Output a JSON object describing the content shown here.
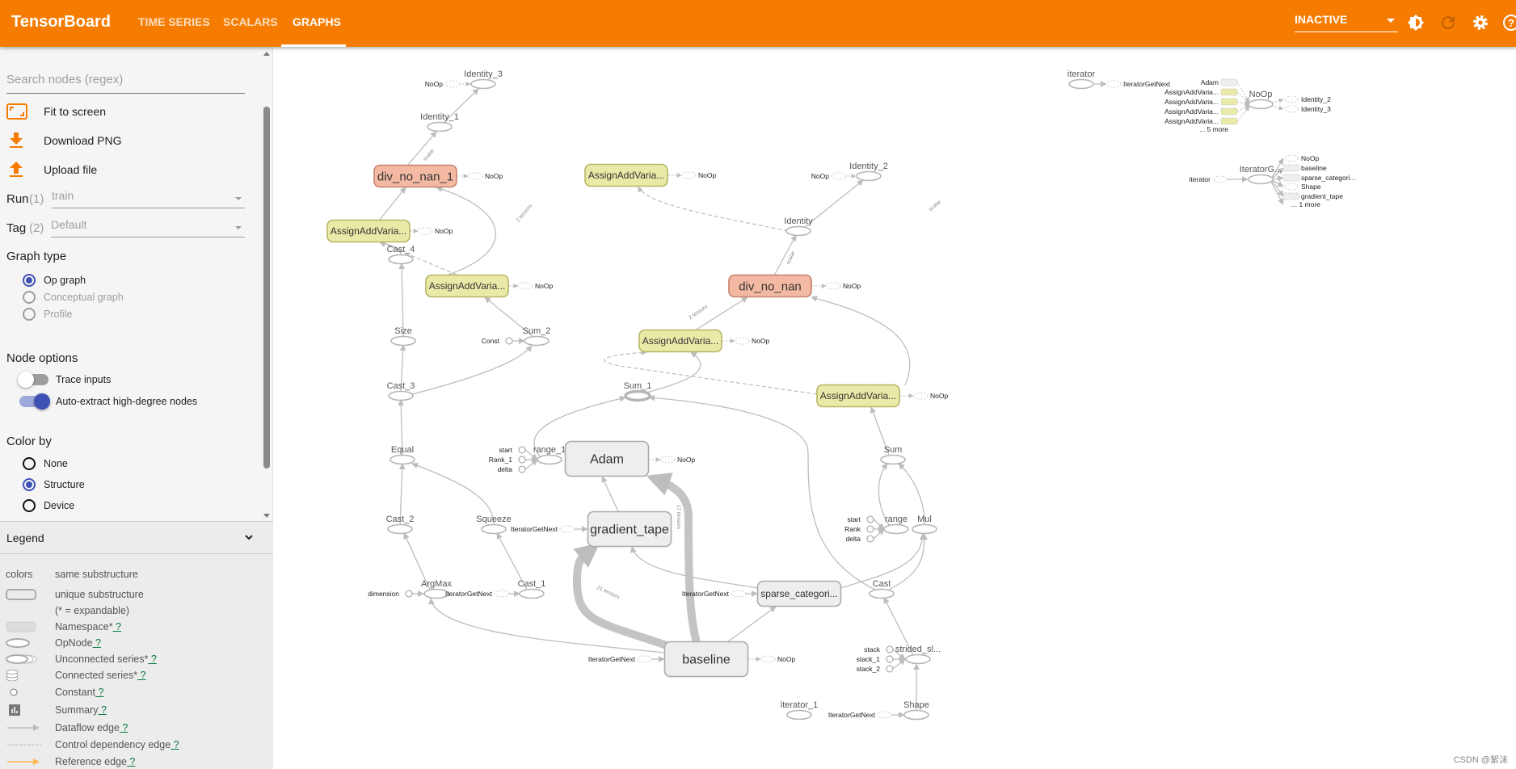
{
  "header": {
    "title": "TensorBoard",
    "tabs": [
      "TIME SERIES",
      "SCALARS",
      "GRAPHS"
    ],
    "active_tab": "GRAPHS",
    "status": "INACTIVE",
    "icons": [
      "brightness-icon",
      "refresh-icon",
      "settings-icon",
      "help-icon"
    ],
    "accent": "#f57c00"
  },
  "sidebar": {
    "search_placeholder": "Search nodes (regex)",
    "actions": [
      {
        "label": "Fit to screen",
        "icon": "fit-screen-icon"
      },
      {
        "label": "Download PNG",
        "icon": "download-icon"
      },
      {
        "label": "Upload file",
        "icon": "upload-icon"
      }
    ],
    "run": {
      "label": "Run",
      "count": "(1)",
      "value": "train"
    },
    "tag": {
      "label": "Tag",
      "count": "(2)",
      "value": "Default"
    },
    "graph_type": {
      "title": "Graph type",
      "options": [
        "Op graph",
        "Conceptual graph",
        "Profile"
      ],
      "selected": "Op graph"
    },
    "node_options": {
      "title": "Node options",
      "toggles": [
        {
          "label": "Trace inputs",
          "on": false
        },
        {
          "label": "Auto-extract high-degree nodes",
          "on": true
        }
      ]
    },
    "color_by": {
      "title": "Color by",
      "options": [
        "None",
        "Structure",
        "Device"
      ],
      "selected": "Structure"
    }
  },
  "legend": {
    "title": "Legend",
    "rows": [
      {
        "key": "colors",
        "label": "same substructure"
      },
      {
        "label": "unique substructure"
      },
      {
        "label": "(* = expandable)"
      },
      {
        "label": "Namespace*",
        "help": "?"
      },
      {
        "label": "OpNode",
        "help": "?"
      },
      {
        "label": "Unconnected series*",
        "help": "?"
      },
      {
        "label": "Connected series*",
        "help": "?"
      },
      {
        "label": "Constant",
        "help": "?"
      },
      {
        "label": "Summary",
        "help": "?"
      },
      {
        "label": "Dataflow edge",
        "help": "?"
      },
      {
        "label": "Control dependency edge",
        "help": "?"
      },
      {
        "label": "Reference edge",
        "help": "?"
      }
    ]
  },
  "graph": {
    "node_colors": {
      "namespace": "#eeeeee",
      "assign": "#eaeaa8",
      "div": "#f4b9a2"
    },
    "nodes": [
      "Identity_3",
      "NoOp",
      "Identity_1",
      "div_no_nan_1",
      "NoOp",
      "AssignAddVaria...",
      "NoOp",
      "Cast_4",
      "AssignAddVaria...",
      "NoOp",
      "Size",
      "Const",
      "Sum_2",
      "Cast_3",
      "Equal",
      "Cast_2",
      "Squeeze",
      "ArgMax",
      "dimension",
      "IteratorGetNext",
      "Cast_1",
      "start",
      "Rank_1",
      "delta",
      "range_1",
      "Adam",
      "NoOp",
      "gradient_tape",
      "IteratorGetNext",
      "baseline",
      "IteratorGetNext",
      "NoOp",
      "sparse_categori...",
      "IteratorGetNext",
      "Sum_1",
      "AssignAddVaria...",
      "NoOp",
      "div_no_nan",
      "NoOp",
      "Identity",
      "Identity_2",
      "NoOp",
      "AssignAddVaria...",
      "NoOp",
      "AssignAddVaria...",
      "NoOp",
      "Sum",
      "start",
      "Rank",
      "delta",
      "range",
      "Mul",
      "Cast",
      "stack",
      "stack_1",
      "stack_2",
      "strided_sl...",
      "Shape",
      "IteratorGetNext",
      "iterator_1",
      "iterator",
      "IteratorGetNext",
      "Adam",
      "AssignAddVaria...",
      "AssignAddVaria...",
      "AssignAddVaria...",
      "AssignAddVaria...",
      "... 5 more",
      "NoOp",
      "Identity_2",
      "Identity_3",
      "iterator",
      "IteratorG...",
      "NoOp",
      "baseline",
      "sparse_categori...",
      "Shape",
      "gradient_tape",
      "... 1 more"
    ],
    "edge_labels": [
      "17 tensors",
      "21 tensors",
      "2 tensors",
      "2 tensors",
      "scalar",
      "scalar",
      "scalar"
    ]
  },
  "watermark": "CSDN @絮沫"
}
